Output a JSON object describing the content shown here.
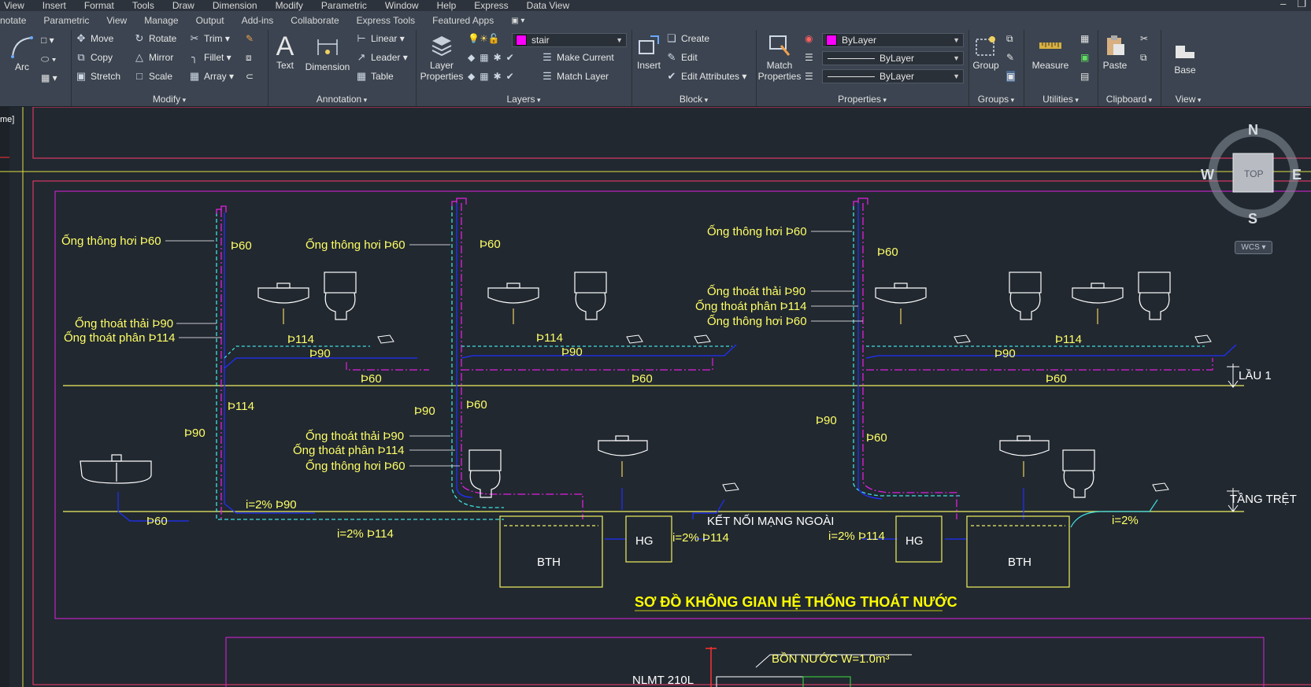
{
  "menu": [
    "View",
    "Insert",
    "Format",
    "Tools",
    "Draw",
    "Dimension",
    "Modify",
    "Parametric",
    "Window",
    "Help",
    "Express",
    "Data View"
  ],
  "tabs": [
    "notate",
    "Parametric",
    "View",
    "Manage",
    "Output",
    "Add-ins",
    "Collaborate",
    "Express Tools",
    "Featured Apps"
  ],
  "ribbon": {
    "draw": {
      "arc": "Arc"
    },
    "modify": {
      "title": "Modify",
      "move": "Move",
      "rotate": "Rotate",
      "trim": "Trim",
      "copy": "Copy",
      "mirror": "Mirror",
      "fillet": "Fillet",
      "stretch": "Stretch",
      "scale": "Scale",
      "array": "Array"
    },
    "annotation": {
      "title": "Annotation",
      "text": "Text",
      "dimension": "Dimension",
      "linear": "Linear",
      "leader": "Leader",
      "table": "Table"
    },
    "layers": {
      "title": "Layers",
      "layer_properties": "Layer Properties",
      "current_layer": "stair",
      "make_current": "Make Current",
      "match_layer": "Match Layer"
    },
    "block": {
      "title": "Block",
      "insert": "Insert",
      "create": "Create",
      "edit": "Edit",
      "edit_attributes": "Edit Attributes"
    },
    "properties": {
      "title": "Properties",
      "match_properties": "Match Properties",
      "color": "ByLayer",
      "linetype": "ByLayer",
      "lineweight": "ByLayer"
    },
    "groups": {
      "title": "Groups",
      "group": "Group"
    },
    "utilities": {
      "title": "Utilities",
      "measure": "Measure"
    },
    "clipboard": {
      "title": "Clipboard",
      "paste": "Paste"
    },
    "view": {
      "title": "View",
      "base": "Base"
    }
  },
  "viewcube": {
    "n": "N",
    "s": "S",
    "e": "E",
    "w": "W",
    "top": "TOP",
    "wcs": "WCS"
  },
  "drawing": {
    "title": "SƠ ĐỒ KHÔNG GIAN HỆ THỐNG THOÁT NƯỚC",
    "floor1": "LẦU 1",
    "ground": "TẦNG TRỆT",
    "external": "KẾT NỐI MẠNG NGOÀI",
    "tank": "BỒN NƯỚC W=1.0m³",
    "solar": "NLMT 210L",
    "bth": "BTH",
    "hg": "HG",
    "vent": "Ống thông hơi Þ60",
    "waste": "Ống thoát thải Þ90",
    "soil": "Ống thoát phân Þ114",
    "d60": "Þ60",
    "d90": "Þ90",
    "d114": "Þ114",
    "slope": "i=2%",
    "slope90": "i=2%  Þ90",
    "slope114": "i=2%  Þ114",
    "side_label": "me]"
  }
}
